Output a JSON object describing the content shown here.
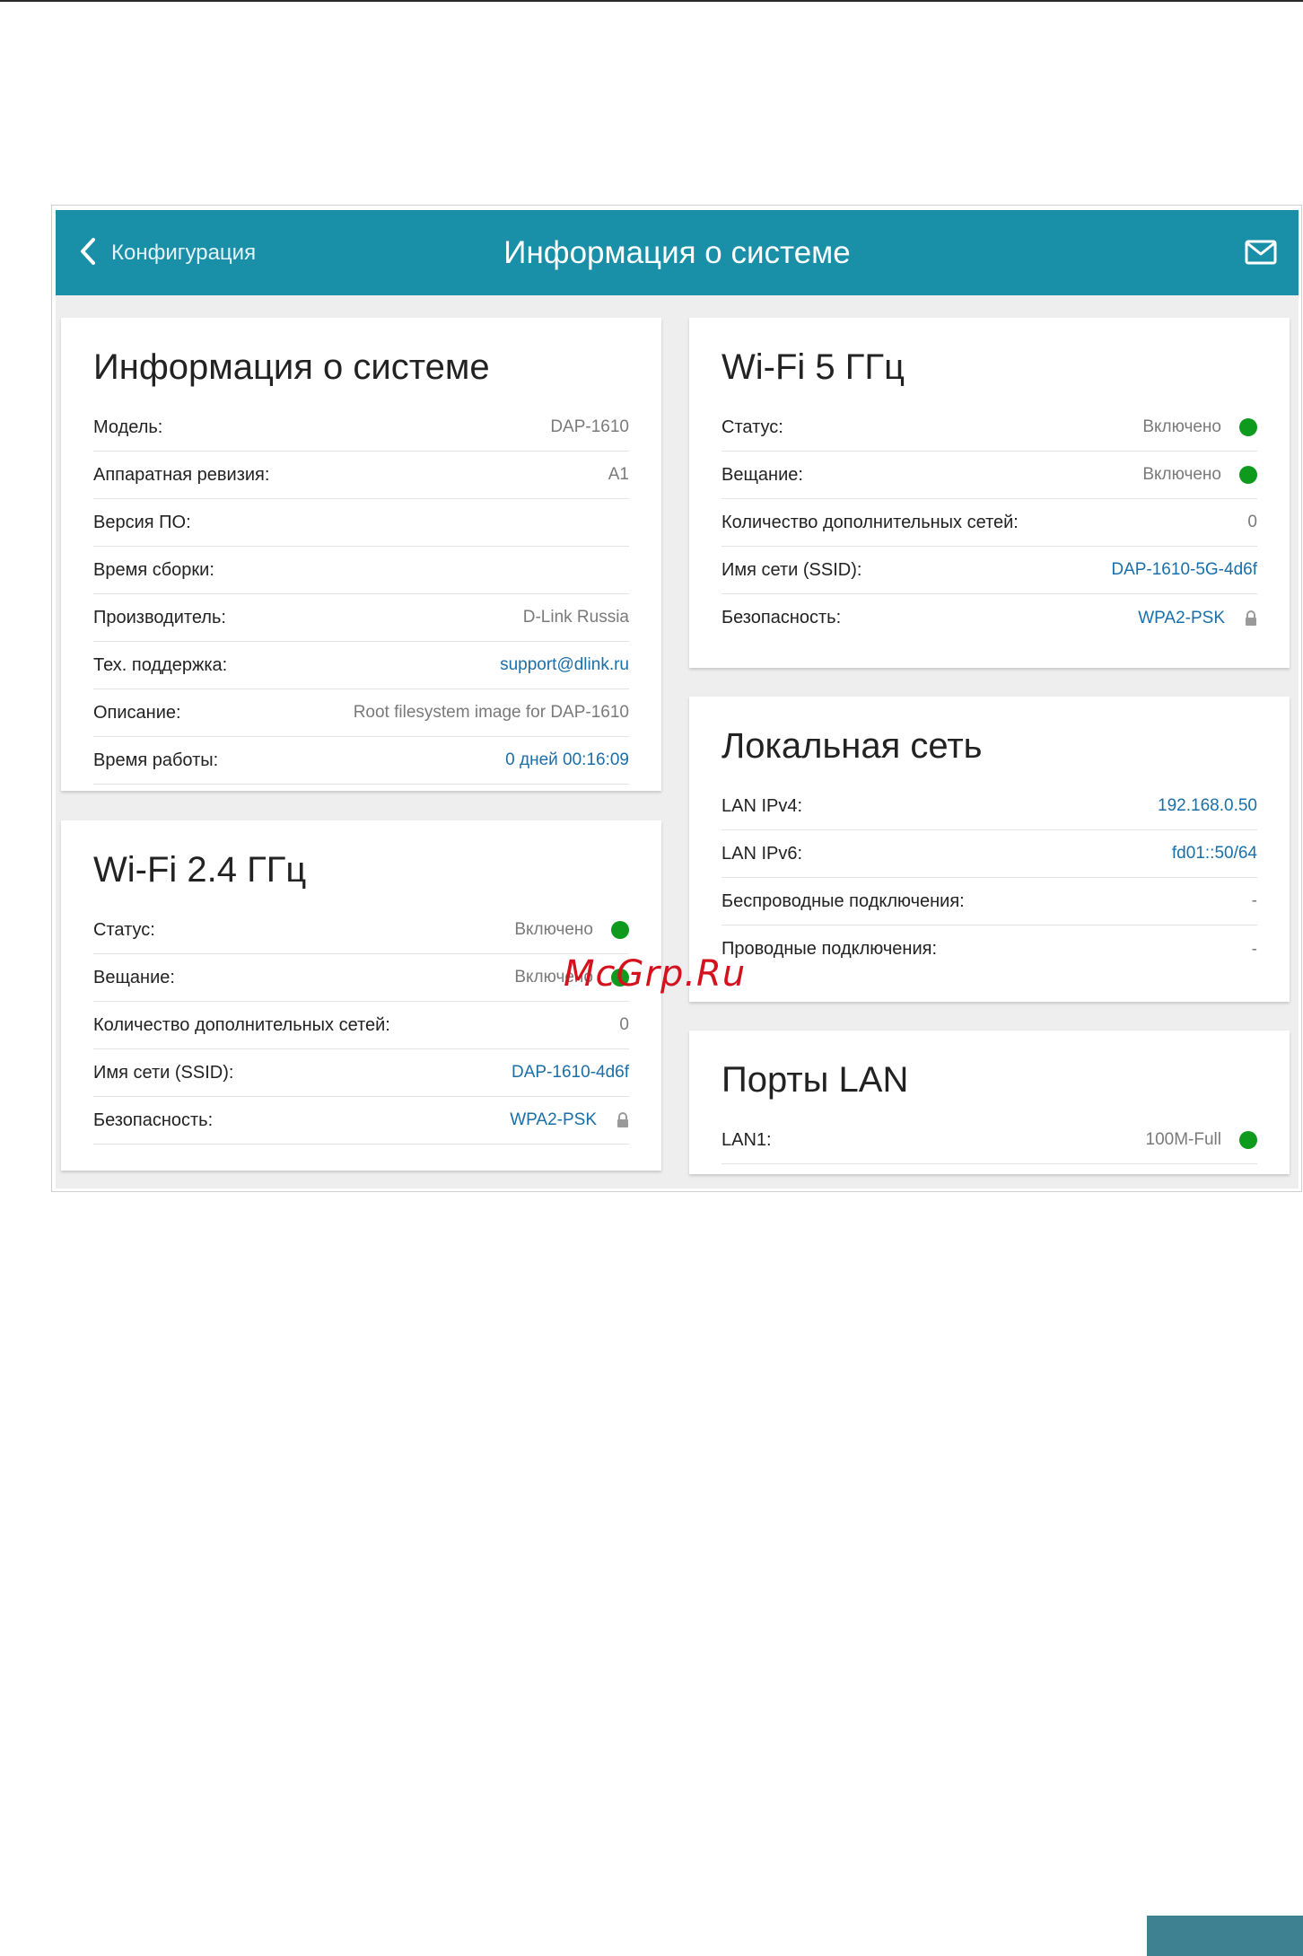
{
  "header": {
    "back_label": "Конфигурация",
    "title": "Информация о системе"
  },
  "icons": {
    "back": "chevron-left-icon",
    "mail": "envelope-icon",
    "status_on": "green-dot-icon",
    "security": "lock-icon"
  },
  "colors": {
    "header_bg": "#1a8fa8",
    "link": "#1a6fa8",
    "status_green": "#0e9a1c"
  },
  "system_info": {
    "title": "Информация о системе",
    "rows": [
      {
        "label": "Модель:",
        "value": "DAP-1610"
      },
      {
        "label": "Аппаратная ревизия:",
        "value": "A1"
      },
      {
        "label": "Версия ПО:",
        "value": ""
      },
      {
        "label": "Время сборки:",
        "value": ""
      },
      {
        "label": "Производитель:",
        "value": "D-Link Russia"
      },
      {
        "label": "Тех. поддержка:",
        "value": "support@dlink.ru"
      },
      {
        "label": "Описание:",
        "value": "Root filesystem image for DAP-1610"
      },
      {
        "label": "Время работы:",
        "value": "0 дней 00:16:09"
      }
    ]
  },
  "wifi24": {
    "title": "Wi-Fi 2.4 ГГц",
    "rows": [
      {
        "label": "Статус:",
        "value": "Включено"
      },
      {
        "label": "Вещание:",
        "value": "Включено"
      },
      {
        "label": "Количество дополнительных сетей:",
        "value": "0"
      },
      {
        "label": "Имя сети (SSID):",
        "value": "DAP-1610-4d6f"
      },
      {
        "label": "Безопасность:",
        "value": "WPA2-PSK"
      }
    ]
  },
  "wifi5": {
    "title": "Wi-Fi 5 ГГц",
    "rows": [
      {
        "label": "Статус:",
        "value": "Включено"
      },
      {
        "label": "Вещание:",
        "value": "Включено"
      },
      {
        "label": "Количество дополнительных сетей:",
        "value": "0"
      },
      {
        "label": "Имя сети (SSID):",
        "value": "DAP-1610-5G-4d6f"
      },
      {
        "label": "Безопасность:",
        "value": "WPA2-PSK"
      }
    ]
  },
  "lan": {
    "title": "Локальная сеть",
    "rows": [
      {
        "label": "LAN IPv4:",
        "value": "192.168.0.50"
      },
      {
        "label": "LAN IPv6:",
        "value": "fd01::50/64"
      },
      {
        "label": "Беспроводные подключения:",
        "value": "-"
      },
      {
        "label": "Проводные подключения:",
        "value": "-"
      }
    ]
  },
  "ports": {
    "title": "Порты LAN",
    "rows": [
      {
        "label": "LAN1:",
        "value": "100M-Full"
      }
    ]
  },
  "watermark": "McGrp.Ru"
}
